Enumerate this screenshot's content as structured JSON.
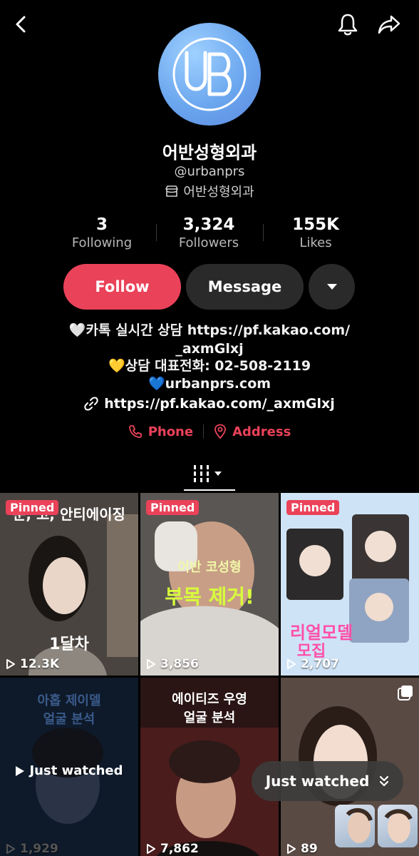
{
  "header": {
    "back_icon": "chevron-left-icon",
    "bell_icon": "bell-icon",
    "share_icon": "share-arrow-icon"
  },
  "profile": {
    "name": "어반성형외과",
    "handle": "@urbanprs",
    "shop_label": "어반성형외과",
    "avatar_letters": "UB",
    "stats": [
      {
        "value": "3",
        "label": "Following"
      },
      {
        "value": "3,324",
        "label": "Followers"
      },
      {
        "value": "155K",
        "label": "Likes"
      }
    ],
    "buttons": {
      "follow": "Follow",
      "message": "Message"
    },
    "bio": {
      "line1": "🤍카톡 실시간 상담 https://pf.kakao.com/",
      "line2": "_axmGlxj",
      "line3": "💛상담 대표전화: 02-508-2119",
      "line4": "💙urbanprs.com",
      "link": "https://pf.kakao.com/_axmGlxj"
    },
    "contacts": {
      "phone": "Phone",
      "address": "Address"
    }
  },
  "videos": [
    {
      "pinned": "Pinned",
      "views": "12.3K",
      "caption_top": "눈, 코, 안티에이징",
      "caption_bottom": "1달차"
    },
    {
      "pinned": "Pinned",
      "views": "3,856",
      "caption_top": "어반 코성형",
      "caption_bottom": "부목 제거!"
    },
    {
      "pinned": "Pinned",
      "views": "2,707",
      "caption_top": "리얼모델",
      "caption_bottom": "모집"
    },
    {
      "views": "1,929",
      "caption_top": "아홉 제이델",
      "caption_bottom": "얼굴 분석",
      "overlay": "Just watched"
    },
    {
      "views": "7,862",
      "caption_top": "에이티즈 우영",
      "caption_bottom": "얼굴 분석"
    },
    {
      "views": "89"
    }
  ],
  "just_watched": {
    "label": "Just watched"
  },
  "colors": {
    "accent": "#ea4259",
    "button_dark": "#2a2a2a",
    "background": "#000000"
  }
}
